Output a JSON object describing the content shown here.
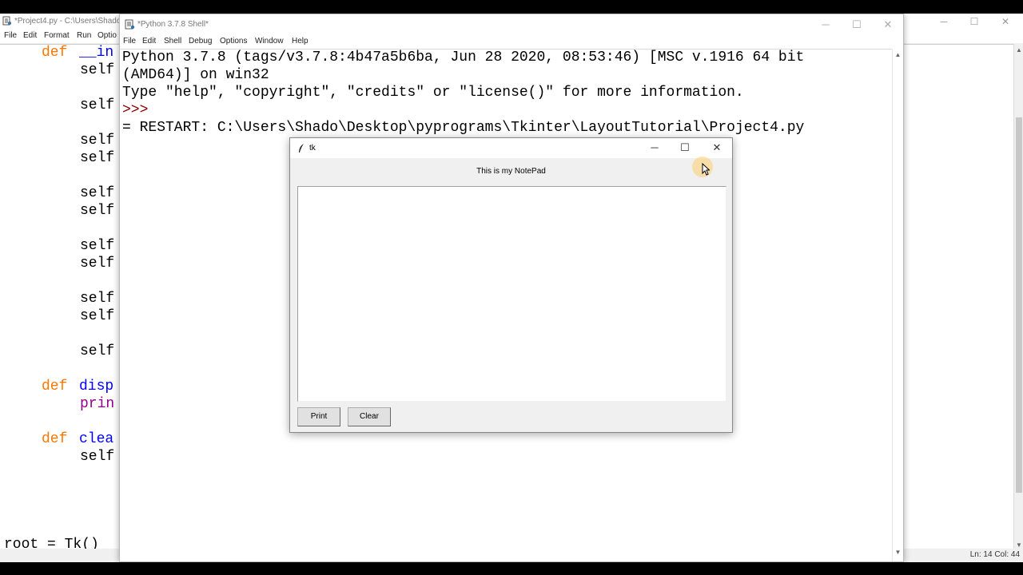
{
  "editor": {
    "title": "*Project4.py - C:\\Users\\Shado",
    "menu": [
      "File",
      "Edit",
      "Format",
      "Run",
      "Optio"
    ],
    "code": {
      "def_kw_1": "def",
      "init_fn": "__in",
      "self": "self",
      "def_kw_2": "def",
      "disp_fn": "disp",
      "print_fn": "prin",
      "def_kw_3": "def",
      "clear_fn": "clea",
      "root_line": "root = Tk()"
    },
    "status": "Ln: 14   Col: 44"
  },
  "shell": {
    "title": "*Python 3.7.8 Shell*",
    "menu": [
      "File",
      "Edit",
      "Shell",
      "Debug",
      "Options",
      "Window",
      "Help"
    ],
    "lines": [
      "Python 3.7.8 (tags/v3.7.8:4b47a5b6ba, Jun 28 2020, 08:53:46) [MSC v.1916 64 bit",
      "(AMD64)] on win32",
      "Type \"help\", \"copyright\", \"credits\" or \"license()\" for more information.",
      ">>>",
      "= RESTART: C:\\Users\\Shado\\Desktop\\pyprograms\\Tkinter\\LayoutTutorial\\Project4.py"
    ]
  },
  "tk": {
    "title": "tk",
    "heading": "This is my NotePad",
    "print_label": "Print",
    "clear_label": "Clear"
  },
  "window_controls": {
    "minimize": "─",
    "maximize": "☐",
    "close": "✕"
  },
  "colors": {
    "keyword": "#ff7700",
    "funcname": "#0000ff",
    "prompt": "#8b0000",
    "builtin": "#900090"
  }
}
